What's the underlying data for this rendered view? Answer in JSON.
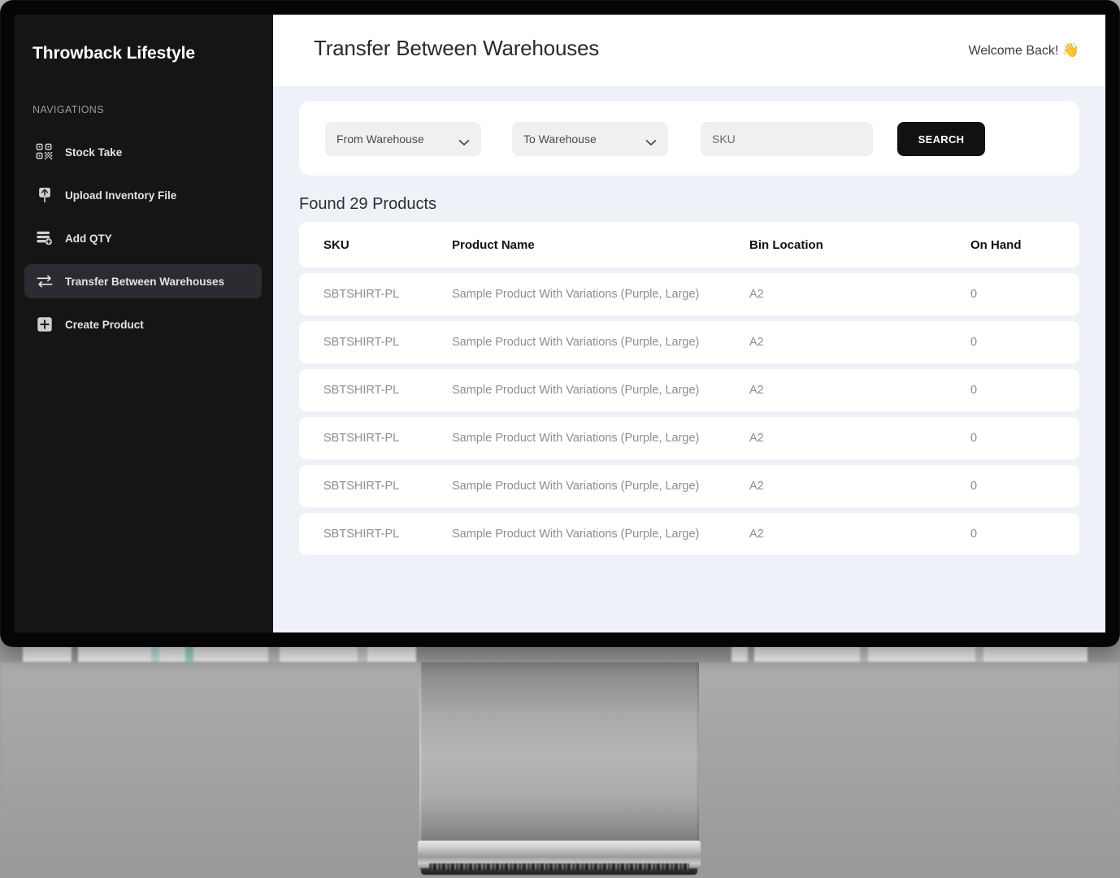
{
  "sidebar": {
    "brand": "Throwback Lifestyle",
    "section_label": "NAVIGATIONS",
    "items": [
      {
        "label": "Stock Take",
        "icon": "qr-code-icon",
        "active": false
      },
      {
        "label": "Upload Inventory File",
        "icon": "upload-icon",
        "active": false
      },
      {
        "label": "Add QTY",
        "icon": "add-quantity-icon",
        "active": false
      },
      {
        "label": "Transfer Between Warehouses",
        "icon": "transfer-arrows-icon",
        "active": true
      },
      {
        "label": "Create Product",
        "icon": "plus-square-icon",
        "active": false
      }
    ]
  },
  "header": {
    "title": "Transfer Between Warehouses",
    "welcome": "Welcome Back!",
    "welcome_emoji": "👋"
  },
  "filters": {
    "from_warehouse_label": "From Warehouse",
    "to_warehouse_label": "To Warehouse",
    "sku_placeholder": "SKU",
    "sku_value": "",
    "search_label": "SEARCH",
    "chevron_icon": "chevron-down-icon"
  },
  "results": {
    "count_text": "Found 29 Products",
    "columns": [
      "SKU",
      "Product Name",
      "Bin Location",
      "On Hand"
    ],
    "rows": [
      {
        "sku": "SBTSHIRT-PL",
        "name": "Sample Product With Variations (Purple, Large)",
        "bin": "A2",
        "on_hand": "0"
      },
      {
        "sku": "SBTSHIRT-PL",
        "name": "Sample Product With Variations (Purple, Large)",
        "bin": "A2",
        "on_hand": "0"
      },
      {
        "sku": "SBTSHIRT-PL",
        "name": "Sample Product With Variations (Purple, Large)",
        "bin": "A2",
        "on_hand": "0"
      },
      {
        "sku": "SBTSHIRT-PL",
        "name": "Sample Product With Variations (Purple, Large)",
        "bin": "A2",
        "on_hand": "0"
      },
      {
        "sku": "SBTSHIRT-PL",
        "name": "Sample Product With Variations (Purple, Large)",
        "bin": "A2",
        "on_hand": "0"
      },
      {
        "sku": "SBTSHIRT-PL",
        "name": "Sample Product With Variations (Purple, Large)",
        "bin": "A2",
        "on_hand": "0"
      }
    ]
  },
  "colors": {
    "sidebar_bg": "#151515",
    "sidebar_active_bg": "#2a2c31",
    "content_bg": "#eef1f7",
    "card_bg": "#ffffff",
    "field_bg": "#f0f0f0",
    "accent_button": "#111111",
    "muted_text": "#8d8d93",
    "emoji_yellow": "#f5c043"
  }
}
